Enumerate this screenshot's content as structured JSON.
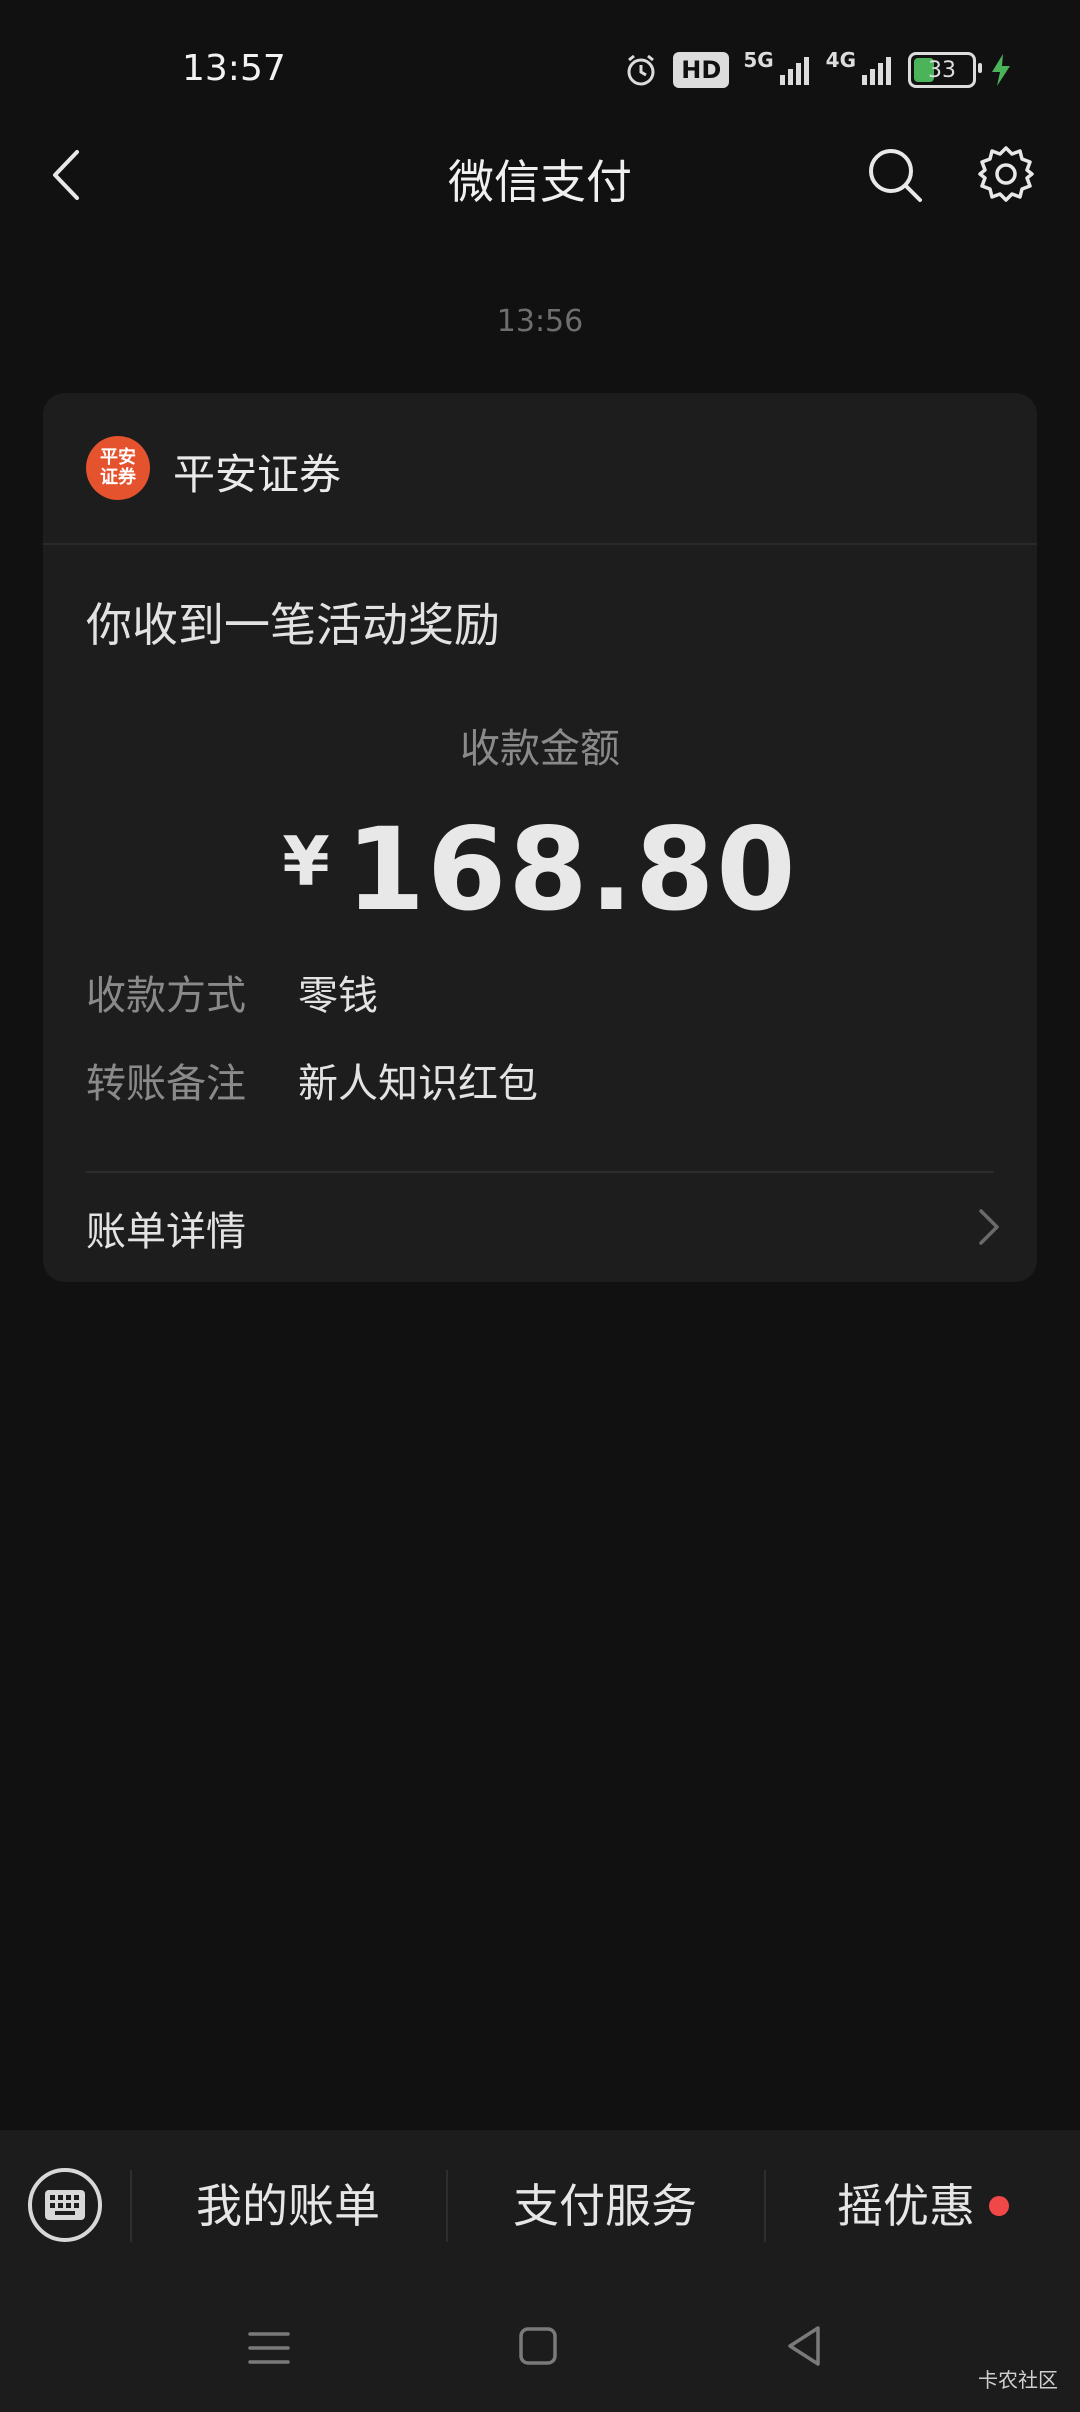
{
  "status_bar": {
    "time": "13:57",
    "hd_label": "HD",
    "net1": "5G",
    "net2": "4G",
    "battery_level": "33"
  },
  "nav": {
    "title": "微信支付",
    "icons": [
      "back-chevron-icon",
      "search-icon",
      "gear-icon"
    ]
  },
  "message": {
    "timestamp": "13:56",
    "merchant_name": "平安证券",
    "logo_text": "平安\n证券",
    "notice_title": "你收到一笔活动奖励",
    "amount_label": "收款金额",
    "currency": "¥",
    "amount": "168.80",
    "rows": [
      {
        "label": "收款方式",
        "value": "零钱"
      },
      {
        "label": "转账备注",
        "value": "新人知识红包"
      }
    ],
    "details_label": "账单详情"
  },
  "bottom_menu": {
    "items": [
      "我的账单",
      "支付服务",
      "摇优惠"
    ]
  },
  "watermark": "卡农社区",
  "colors": {
    "background": "#111111",
    "card": "#1d1d1d",
    "logo": "#e5522e",
    "badge_dot": "#f04848",
    "charging": "#4bb35a"
  }
}
